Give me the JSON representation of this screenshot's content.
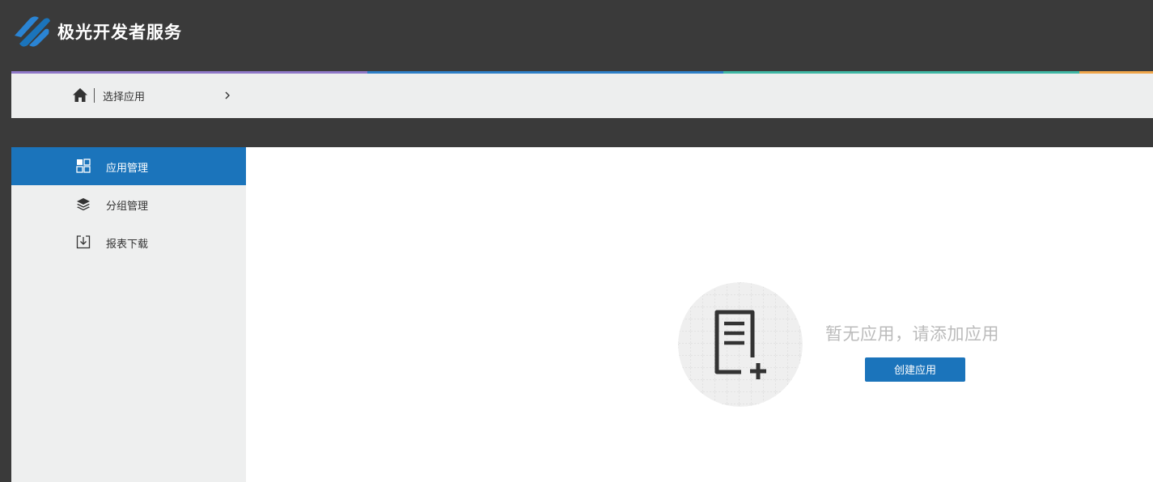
{
  "header": {
    "brand": "极光开发者服务",
    "logo_icon": "jiguang-logo-icon"
  },
  "colors": {
    "strip": [
      "#8f78c8",
      "#2e7fc7",
      "#3fb7a4",
      "#f0a64a"
    ],
    "primary": "#1b74bb",
    "topbar": "#3a3a3a",
    "sidebar_bg": "#eeefef"
  },
  "breadcrumb": {
    "home_icon": "home-icon",
    "current": "选择应用",
    "chevron_icon": "chevron-right-icon"
  },
  "sidebar": {
    "items": [
      {
        "label": "应用管理",
        "icon": "apps-grid-icon",
        "active": true
      },
      {
        "label": "分组管理",
        "icon": "layers-icon",
        "active": false
      },
      {
        "label": "报表下载",
        "icon": "download-icon",
        "active": false
      }
    ]
  },
  "main": {
    "empty_illustration_icon": "document-add-icon",
    "empty_message": "暂无应用，请添加应用",
    "create_button_label": "创建应用"
  }
}
